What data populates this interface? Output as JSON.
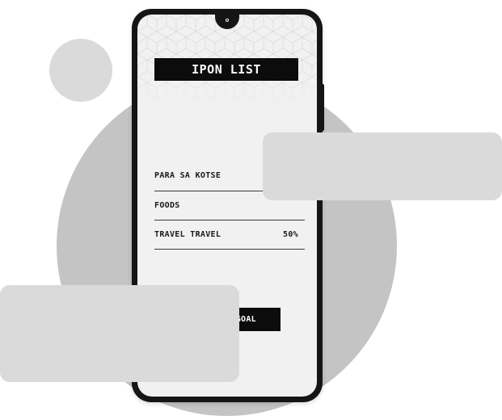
{
  "app": {
    "title": "IPON LIST"
  },
  "list": {
    "items": [
      {
        "name": "PARA SA KOTSE",
        "percent": ""
      },
      {
        "name": "FOODS",
        "percent": ""
      },
      {
        "name": "TRAVEL TRAVEL",
        "percent": "50%"
      }
    ]
  },
  "actions": {
    "goal_label": "GOAL"
  },
  "colors": {
    "screen_bg": "#f1f1f1",
    "title_bg": "#0c0c0c",
    "phone_body": "#151515",
    "card_bg": "#dadada",
    "circle_big": "#c4c4c4"
  }
}
